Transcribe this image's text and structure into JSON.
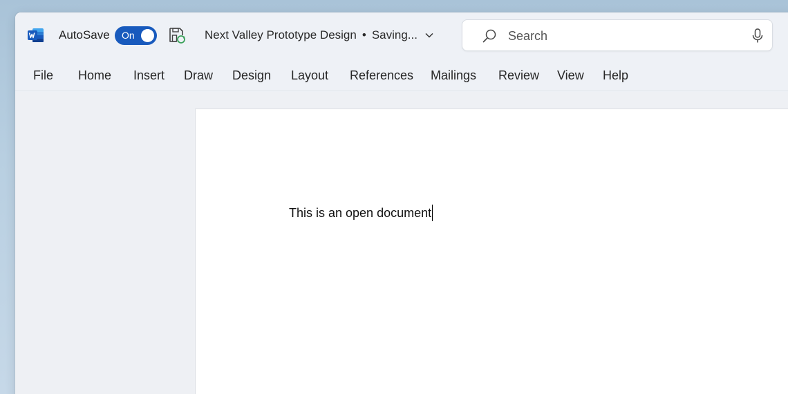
{
  "titlebar": {
    "autosave_label": "AutoSave",
    "autosave_state": "On",
    "document_title": "Next Valley Prototype Design",
    "separator": "•",
    "status": "Saving...",
    "icons": {
      "app": "word-icon",
      "save": "save-sync-icon",
      "dropdown": "chevron-down-icon"
    }
  },
  "search": {
    "placeholder": "Search",
    "value": "",
    "icons": {
      "search": "search-icon",
      "voice": "microphone-icon"
    }
  },
  "tabs": [
    {
      "label": "File"
    },
    {
      "label": "Home"
    },
    {
      "label": "Insert"
    },
    {
      "label": "Draw"
    },
    {
      "label": "Design"
    },
    {
      "label": "Layout"
    },
    {
      "label": "References"
    },
    {
      "label": "Mailings"
    },
    {
      "label": "Review"
    },
    {
      "label": "View"
    },
    {
      "label": "Help"
    }
  ],
  "document": {
    "body_text": "This is an open document"
  },
  "colors": {
    "accent": "#185abd",
    "word_brand": "#185abd",
    "window_bg": "#eef1f6",
    "page_bg": "#ffffff"
  }
}
